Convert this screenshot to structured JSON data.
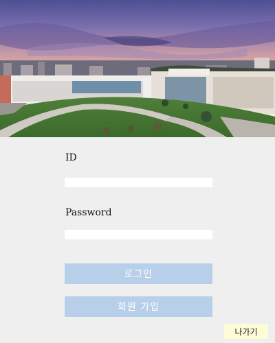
{
  "login": {
    "id_label": "ID",
    "id_value": "",
    "password_label": "Password",
    "password_value": "",
    "login_button": "로그인",
    "signup_button": "회원 가입",
    "exit_button": "나가기"
  },
  "colors": {
    "background": "#efefef",
    "button_bg": "#b8cfea",
    "button_text": "#ffffff",
    "exit_bg": "#fefcd6"
  },
  "hero_image": "campus-photo"
}
